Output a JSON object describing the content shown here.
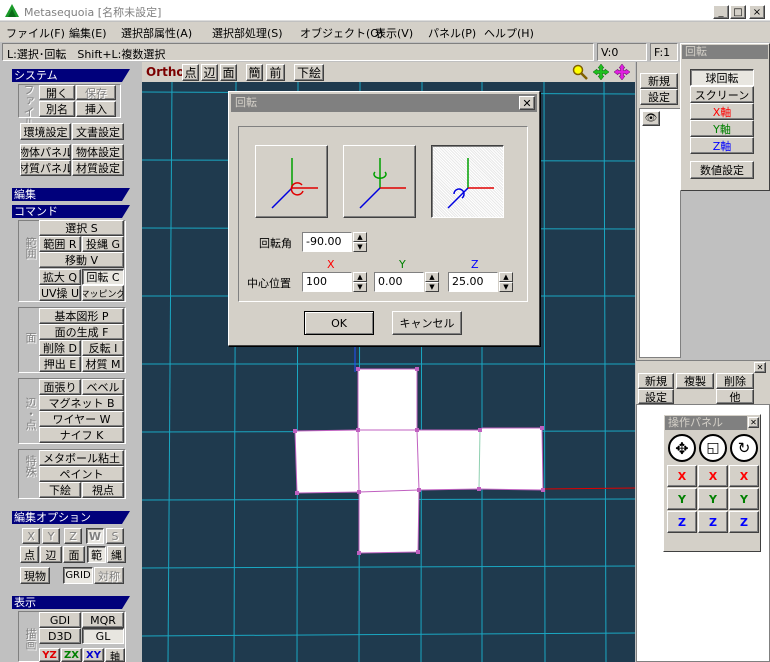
{
  "window": {
    "title": "Metasequoia [名称未設定]",
    "controls": [
      "_",
      "□",
      "×"
    ]
  },
  "menu": [
    "ファイル(F)",
    "編集(E)",
    "選択部属性(A)",
    "選択部処理(S)",
    "オブジェクト(O)",
    "表示(V)",
    "パネル(P)",
    "ヘルプ(H)"
  ],
  "status": {
    "hint": "L:選択･回転　Shift+L:複数選択",
    "v": "V:0",
    "f": "F:1"
  },
  "sidebar": {
    "system": {
      "header": "システム",
      "file_label": "ファイル",
      "open": "開く",
      "save": "保存",
      "saveas": "別名",
      "insert": "挿入",
      "env": "環境設定",
      "docset": "文書設定",
      "objpanel": "物体パネル",
      "objset": "物体設定",
      "matpanel": "材質パネル",
      "matset": "材質設定"
    },
    "edit_header": "編集",
    "command": {
      "header": "コマンド",
      "range_label": "範囲",
      "select": "選択 S",
      "range": "範囲 R",
      "lasso": "投縄 G",
      "move": "移動 V",
      "scale": "拡大 Q",
      "rotate": "回転 C",
      "uv": "UV操 U",
      "mapping": "マッピング",
      "face_label": "面",
      "basic": "基本図形 P",
      "facegen": "面の生成 F",
      "delete": "削除 D",
      "flip": "反転 I",
      "extrude": "押出 E",
      "material": "材質 M",
      "edge_label": "辺・点",
      "stretch": "面張り",
      "bevel": "ベベル",
      "magnet": "マグネット B",
      "wire": "ワイヤー W",
      "knife": "ナイフ K",
      "special_label": "特殊",
      "metaball": "メタボール粘土",
      "paint": "ペイント",
      "underlay": "下絵",
      "viewpoint": "視点"
    },
    "edit_options": {
      "header": "編集オプション",
      "x": "X",
      "y": "Y",
      "z": "Z",
      "w": "W",
      "s": "S",
      "point": "点",
      "edge": "辺",
      "face": "面",
      "range": "範",
      "lasso": "縄",
      "current": "現物",
      "grid": "GRID",
      "symmetry": "対称"
    },
    "display": {
      "header": "表示",
      "draw_label": "描画",
      "gdi": "GDI",
      "mqr": "MQR",
      "d3d": "D3D",
      "gl": "GL",
      "yz": "YZ",
      "zx": "ZX",
      "xy": "XY",
      "persp": "軸"
    }
  },
  "viewtoolbar": {
    "ortho": "Ortho",
    "point": "点",
    "edge": "辺",
    "face": "面",
    "simple": "簡",
    "front": "前",
    "underlay": "下絵"
  },
  "dialog": {
    "title": "回転",
    "angle_label": "回転角",
    "angle_value": "-90.00",
    "center_label": "中心位置",
    "x_label": "X",
    "y_label": "Y",
    "z_label": "Z",
    "x_value": "100",
    "y_value": "0.00",
    "z_value": "25.00",
    "ok": "OK",
    "cancel": "キャンセル",
    "colors": {
      "x": "#ff0000",
      "y": "#008000",
      "z": "#0000ff"
    }
  },
  "objpanel": {
    "new": "新規",
    "settings": "設定"
  },
  "rotpanel": {
    "title": "回転",
    "sphere": "球回転",
    "screen": "スクリーン",
    "xaxis": "X軸",
    "yaxis": "Y軸",
    "zaxis": "Z軸",
    "numeric": "数値設定"
  },
  "matpanel": {
    "new": "新規",
    "copy": "複製",
    "delete": "削除",
    "settings": "設定",
    "other": "他"
  },
  "oppanel": {
    "title": "操作パネル",
    "x": "X",
    "y": "Y",
    "z": "Z"
  }
}
